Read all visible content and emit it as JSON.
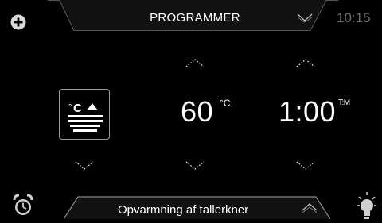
{
  "header": {
    "title": "PROGRAMMER",
    "clock": "10:15"
  },
  "settings": {
    "program_icon": "dish-warming-program-icon",
    "temperature": {
      "value": "60",
      "unit": "°C"
    },
    "duration": {
      "value": "1:00",
      "unit": "T:M"
    }
  },
  "footer": {
    "label": "Opvarmning af tallerkner"
  },
  "colors": {
    "background": "#000000",
    "text": "#ffffff",
    "muted": "#6d6d6d",
    "border": "#8a8a8a"
  },
  "icons": [
    "plus-icon",
    "chevron-down-icon",
    "chevron-up-icon",
    "alarm-clock-icon",
    "light-bulb-icon"
  ]
}
